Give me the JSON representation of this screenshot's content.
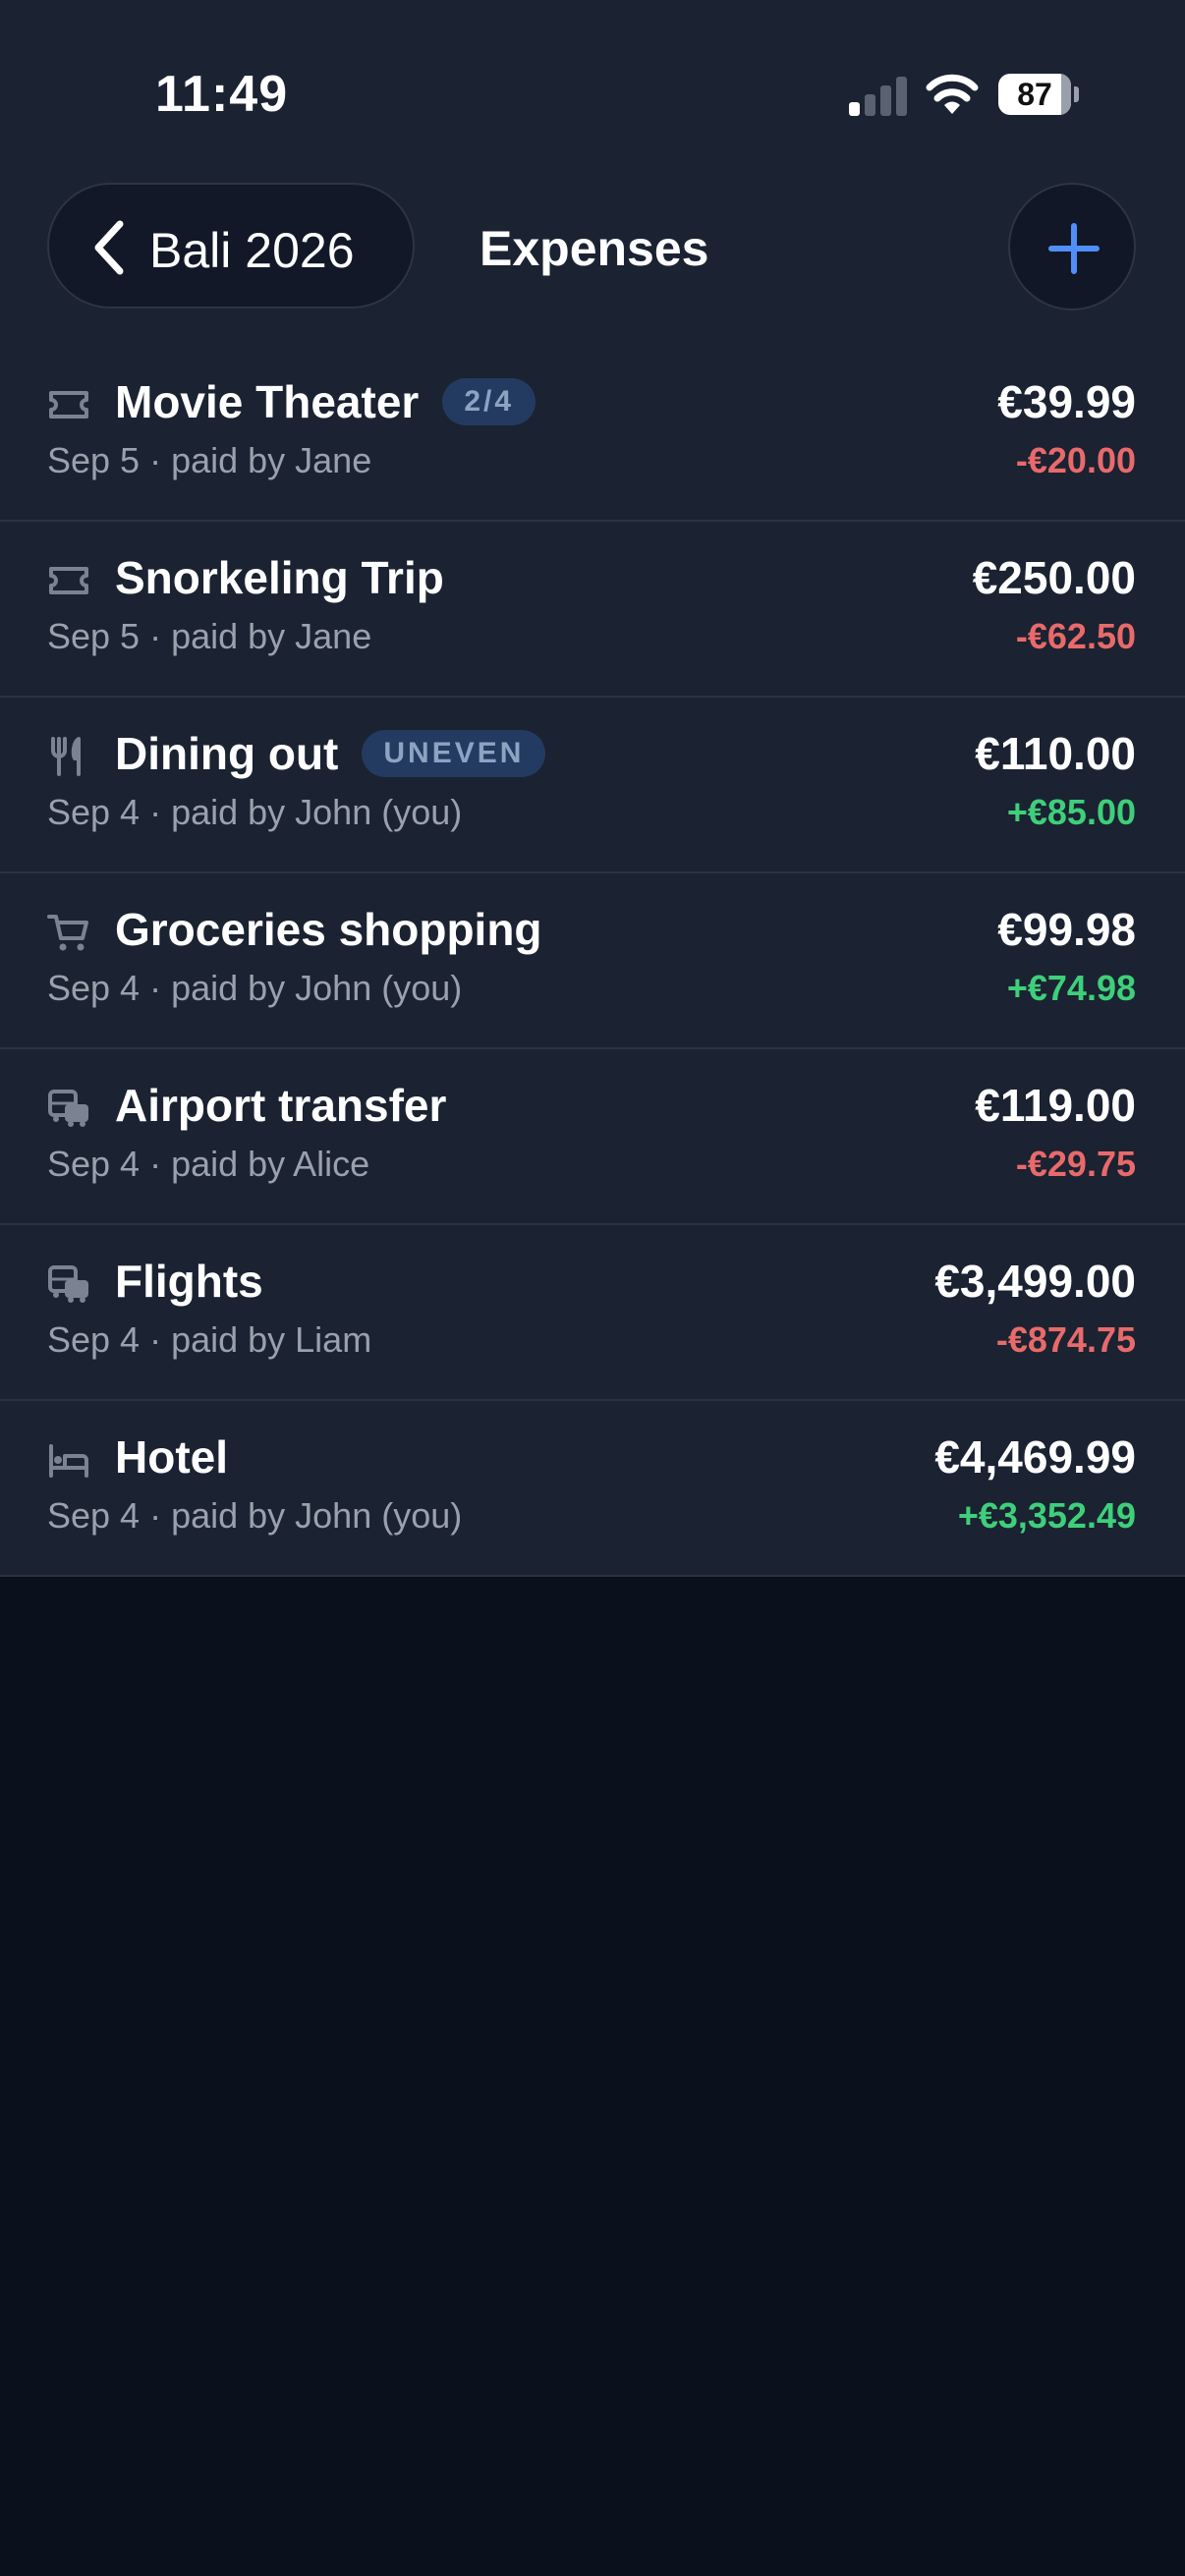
{
  "status_bar": {
    "time": "11:49",
    "battery": "87",
    "signal_icon": "cellular-signal-icon",
    "wifi_icon": "wifi-icon"
  },
  "header": {
    "back_label": "Bali 2026",
    "title": "Expenses",
    "add_icon": "plus-icon"
  },
  "colors": {
    "background": "#0b101d",
    "row_background": "#1b2231",
    "accent": "#4f8ff7",
    "negative": "#e86a6a",
    "positive": "#3ecf7a",
    "badge_background": "#233b61"
  },
  "expenses": [
    {
      "icon": "ticket-icon",
      "title": "Movie Theater",
      "badge": "2/4",
      "subtitle": "Sep 5 · paid by Jane",
      "amount": "€39.99",
      "balance": "-€20.00",
      "balance_sign": "negative"
    },
    {
      "icon": "ticket-icon",
      "title": "Snorkeling Trip",
      "badge": "",
      "subtitle": "Sep 5 · paid by Jane",
      "amount": "€250.00",
      "balance": "-€62.50",
      "balance_sign": "negative"
    },
    {
      "icon": "utensils-icon",
      "title": "Dining out",
      "badge": "UNEVEN",
      "subtitle": "Sep 4 · paid by John (you)",
      "amount": "€110.00",
      "balance": "+€85.00",
      "balance_sign": "positive"
    },
    {
      "icon": "shopping-cart-icon",
      "title": "Groceries shopping",
      "badge": "",
      "subtitle": "Sep 4 · paid by John (you)",
      "amount": "€99.98",
      "balance": "+€74.98",
      "balance_sign": "positive"
    },
    {
      "icon": "transport-icon",
      "title": "Airport transfer",
      "badge": "",
      "subtitle": "Sep 4 · paid by Alice",
      "amount": "€119.00",
      "balance": "-€29.75",
      "balance_sign": "negative"
    },
    {
      "icon": "transport-icon",
      "title": "Flights",
      "badge": "",
      "subtitle": "Sep 4 · paid by Liam",
      "amount": "€3,499.00",
      "balance": "-€874.75",
      "balance_sign": "negative"
    },
    {
      "icon": "bed-icon",
      "title": "Hotel",
      "badge": "",
      "subtitle": "Sep 4 · paid by John (you)",
      "amount": "€4,469.99",
      "balance": "+€3,352.49",
      "balance_sign": "positive"
    }
  ]
}
